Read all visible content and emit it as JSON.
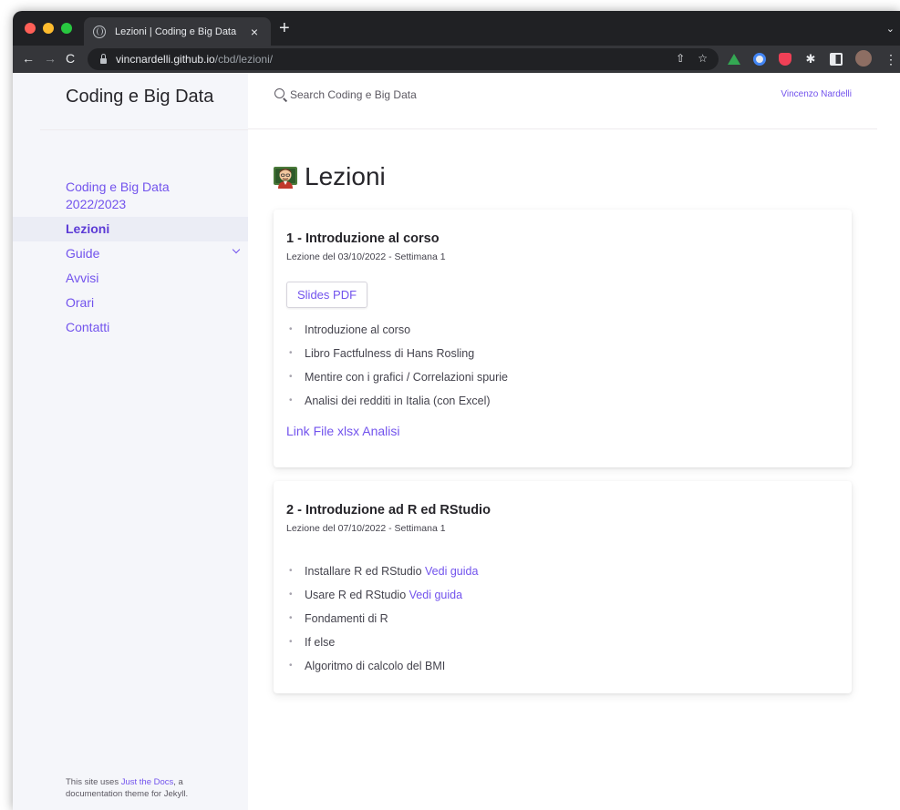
{
  "browser": {
    "tab_title": "Lezioni | Coding e Big Data",
    "tab_close": "×",
    "new_tab": "+",
    "url_host": "vincnardelli.github.io",
    "url_path": "/cbd/lezioni/",
    "back": "←",
    "forward": "→",
    "reload": "C",
    "share": "⇧",
    "bookmark": "☆",
    "puzzle": "✱",
    "more": "⋮",
    "tab_menu": "⌄"
  },
  "sidebar": {
    "site_title": "Coding e Big Data",
    "items": [
      {
        "label": "Coding e Big Data 2022/2023"
      },
      {
        "label": "Lezioni"
      },
      {
        "label": "Guide"
      },
      {
        "label": "Avvisi"
      },
      {
        "label": "Orari"
      },
      {
        "label": "Contatti"
      }
    ],
    "footer_prefix": "This site uses ",
    "footer_link": "Just the Docs",
    "footer_suffix": ", a documentation theme for Jekyll."
  },
  "header": {
    "search_placeholder": "Search Coding e Big Data",
    "aux_link": "Vincenzo Nardelli"
  },
  "main": {
    "title": "Lezioni",
    "lessons": [
      {
        "title": "1 - Introduzione al corso",
        "date": "Lezione del 03/10/2022 - Settimana 1",
        "slides_button": "Slides PDF",
        "topics": [
          "Introduzione al corso",
          "Libro Factfulness di Hans Rosling",
          "Mentire con i grafici / Correlazioni spurie",
          "Analisi dei redditi in Italia (con Excel)"
        ],
        "file_link": "Link File xlsx Analisi"
      },
      {
        "title": "2 - Introduzione ad R ed RStudio",
        "date": "Lezione del 07/10/2022 - Settimana 1",
        "topics": [
          {
            "text": "Installare R ed RStudio ",
            "link": "Vedi guida"
          },
          {
            "text": "Usare R ed RStudio ",
            "link": "Vedi guida"
          },
          {
            "text": "Fondamenti di R"
          },
          {
            "text": "If else"
          },
          {
            "text": "Algoritmo di calcolo del BMI"
          }
        ]
      }
    ]
  },
  "colors": {
    "accent": "#7253ed",
    "sidebar_bg": "#f5f6fa",
    "chrome_dark": "#202124"
  }
}
